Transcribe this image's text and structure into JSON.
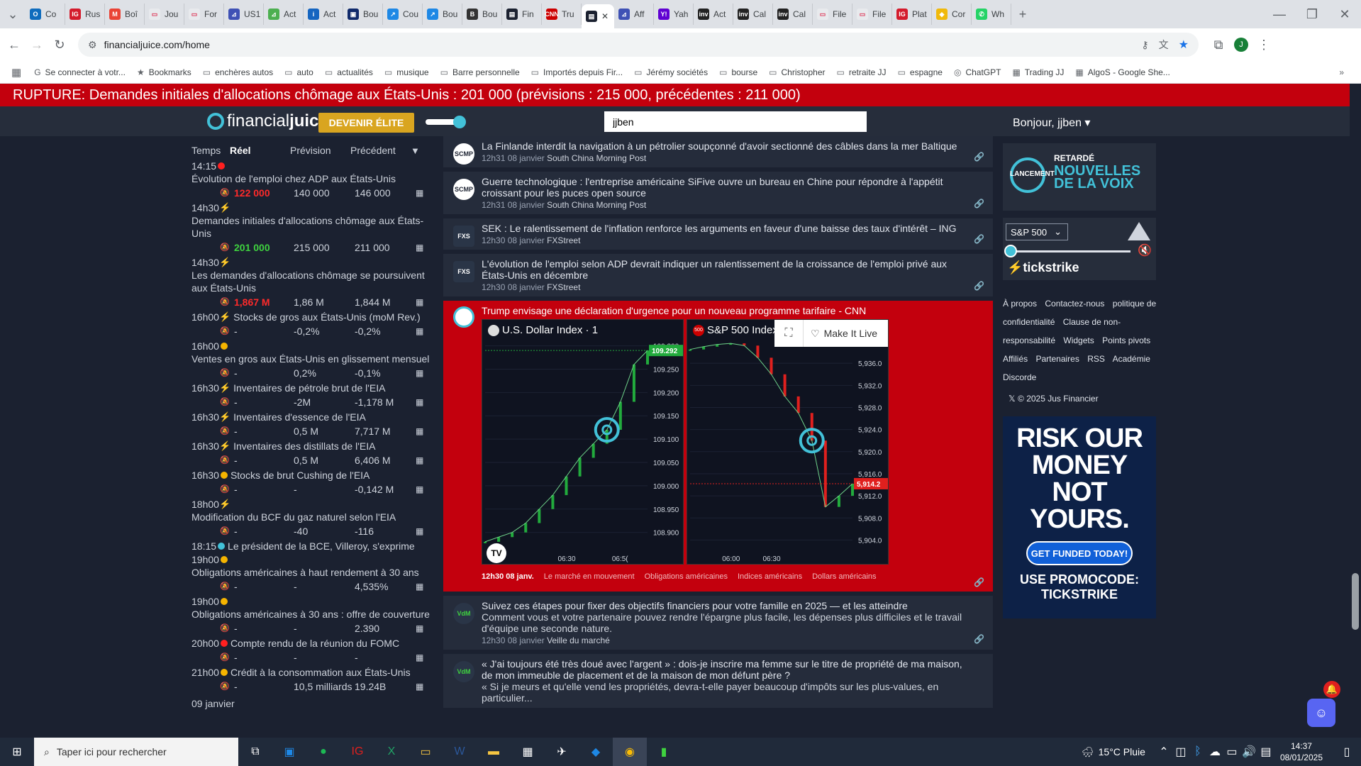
{
  "browser": {
    "tabs": [
      {
        "label": "Co",
        "color": "#0f6cbd",
        "glyph": "O"
      },
      {
        "label": "Rus",
        "color": "#d41b2c",
        "glyph": "IG"
      },
      {
        "label": "Boî",
        "color": "#ea4335",
        "glyph": "M"
      },
      {
        "label": "Jou",
        "color": "#e8eaed",
        "glyph": "▭"
      },
      {
        "label": "For",
        "color": "#e8eaed",
        "glyph": "▭"
      },
      {
        "label": "US1",
        "color": "#3f51b5",
        "glyph": "⊿"
      },
      {
        "label": "Act",
        "color": "#4caf50",
        "glyph": "⊿"
      },
      {
        "label": "Act",
        "color": "#1565c0",
        "glyph": "i"
      },
      {
        "label": "Bou",
        "color": "#102a6b",
        "glyph": "▣"
      },
      {
        "label": "Cou",
        "color": "#1e88e5",
        "glyph": "↗"
      },
      {
        "label": "Bou",
        "color": "#1e88e5",
        "glyph": "↗"
      },
      {
        "label": "Bou",
        "color": "#333333",
        "glyph": "B"
      },
      {
        "label": "Fin",
        "color": "#1b2130",
        "glyph": "▤"
      },
      {
        "label": "Tru",
        "color": "#cc0000",
        "glyph": "CNN"
      },
      {
        "label": "",
        "color": "#1b2130",
        "glyph": "▤",
        "active": true
      },
      {
        "label": "Aff",
        "color": "#3f51b5",
        "glyph": "⊿"
      },
      {
        "label": "Yah",
        "color": "#6001d2",
        "glyph": "Y!"
      },
      {
        "label": "Act",
        "color": "#222222",
        "glyph": "inv"
      },
      {
        "label": "Cal",
        "color": "#222222",
        "glyph": "inv"
      },
      {
        "label": "Cal",
        "color": "#222222",
        "glyph": "inv"
      },
      {
        "label": "File",
        "color": "#e8eaed",
        "glyph": "▭"
      },
      {
        "label": "File",
        "color": "#e8eaed",
        "glyph": "▭"
      },
      {
        "label": "Plat",
        "color": "#d41b2c",
        "glyph": "IG"
      },
      {
        "label": "Cor",
        "color": "#f0b90b",
        "glyph": "◆"
      },
      {
        "label": "Wh",
        "color": "#25d366",
        "glyph": "✆"
      }
    ],
    "url": "financialjuice.com/home",
    "profile_initial": "J",
    "bookmarks": [
      {
        "icon": "G",
        "label": "Se connecter à votr..."
      },
      {
        "icon": "★",
        "label": "Bookmarks"
      },
      {
        "icon": "▭",
        "label": "enchères autos"
      },
      {
        "icon": "▭",
        "label": "auto"
      },
      {
        "icon": "▭",
        "label": "actualités"
      },
      {
        "icon": "▭",
        "label": "musique"
      },
      {
        "icon": "▭",
        "label": "Barre personnelle"
      },
      {
        "icon": "▭",
        "label": "Importés depuis Fir..."
      },
      {
        "icon": "▭",
        "label": "Jérémy sociétés"
      },
      {
        "icon": "▭",
        "label": "bourse"
      },
      {
        "icon": "▭",
        "label": "Christopher"
      },
      {
        "icon": "▭",
        "label": "retraite JJ"
      },
      {
        "icon": "▭",
        "label": "espagne"
      },
      {
        "icon": "◎",
        "label": "ChatGPT"
      },
      {
        "icon": "▦",
        "label": "Trading JJ"
      },
      {
        "icon": "▦",
        "label": "AlgoS - Google She..."
      }
    ]
  },
  "site": {
    "breaking": "RUPTURE: Demandes initiales d'allocations chômage aux États-Unis : 201 000 (prévisions : 215 000, précédentes : 211 000)",
    "logo_light": "financial",
    "logo_bold": "juice",
    "elite_button": "DEVENIR ÉLITE",
    "search_value": "jjben",
    "greeting": "Bonjour, jjben ▾"
  },
  "calendar": {
    "headers": {
      "time": "Temps",
      "actual": "Réel",
      "forecast": "Prévision",
      "previous": "Précédent"
    },
    "events": [
      {
        "time": "14:15",
        "impact": "#ff2020",
        "title": "Évolution de l'emploi chez ADP aux États-Unis",
        "actual": "122 000",
        "actual_color": "#ff2a2a",
        "forecast": "140 000",
        "previous": "146 000",
        "title_inline": false
      },
      {
        "time": "14h30",
        "impact": "bolt-red",
        "title": "Demandes initiales d'allocations chômage aux États-Unis",
        "actual": "201 000",
        "actual_color": "#3fd23f",
        "forecast": "215 000",
        "previous": "211 000",
        "title_inline": false
      },
      {
        "time": "14h30",
        "impact": "bolt-yellow",
        "title": "Les demandes d'allocations chômage se poursuivent aux États-Unis",
        "actual": "1,867 M",
        "actual_color": "#ff2a2a",
        "forecast": "1,86 M",
        "previous": "1,844 M",
        "title_inline": false
      },
      {
        "time": "16h00",
        "impact": "bolt-yellow",
        "title": "Stocks de gros aux États-Unis (moM Rev.)",
        "actual": "-",
        "actual_color": "#cdd2db",
        "forecast": "-0,2%",
        "previous": "-0,2%",
        "title_inline": true
      },
      {
        "time": "16h00",
        "impact": "#f5b400",
        "title": "Ventes en gros aux États-Unis en glissement mensuel",
        "actual": "-",
        "actual_color": "#cdd2db",
        "forecast": "0,2%",
        "previous": "-0,1%",
        "title_inline": false
      },
      {
        "time": "16h30",
        "impact": "bolt-red",
        "title": "Inventaires de pétrole brut de l'EIA",
        "actual": "-",
        "actual_color": "#cdd2db",
        "forecast": "-2M",
        "previous": "-1,178 M",
        "title_inline": true
      },
      {
        "time": "16h30",
        "impact": "bolt-yellow",
        "title": "Inventaires d'essence de l'EIA",
        "actual": "-",
        "actual_color": "#cdd2db",
        "forecast": "0,5 M",
        "previous": "7,717 M",
        "title_inline": true
      },
      {
        "time": "16h30",
        "impact": "bolt-yellow",
        "title": "Inventaires des distillats de l'EIA",
        "actual": "-",
        "actual_color": "#cdd2db",
        "forecast": "0,5 M",
        "previous": "6,406 M",
        "title_inline": true
      },
      {
        "time": "16h30",
        "impact": "#f5b400",
        "title": "Stocks de brut Cushing de l'EIA",
        "actual": "-",
        "actual_color": "#cdd2db",
        "forecast": "-",
        "previous": "-0,142 M",
        "title_inline": true
      },
      {
        "time": "18h00",
        "impact": "bolt-yellow",
        "title": "Modification du BCF du gaz naturel selon l'EIA",
        "actual": "-",
        "actual_color": "#cdd2db",
        "forecast": "-40",
        "previous": "-116",
        "title_inline": false
      },
      {
        "time": "18:15",
        "impact": "#42c1d8",
        "title": "Le président de la BCE, Villeroy, s'exprime",
        "actual": null,
        "title_inline": true
      },
      {
        "time": "19h00",
        "impact": "#f5b400",
        "title": "Obligations américaines à haut rendement à 30 ans",
        "actual": "-",
        "actual_color": "#cdd2db",
        "forecast": "-",
        "previous": "4,535%",
        "title_inline": false
      },
      {
        "time": "19h00",
        "impact": "#f5b400",
        "title": "Obligations américaines à 30 ans : offre de couverture",
        "actual": "-",
        "actual_color": "#cdd2db",
        "forecast": "-",
        "previous": "2.390",
        "title_inline": false
      },
      {
        "time": "20h00",
        "impact": "#ff2020",
        "title": "Compte rendu de la réunion du FOMC",
        "actual": "-",
        "actual_color": "#cdd2db",
        "forecast": "-",
        "previous": "-",
        "title_inline": true
      },
      {
        "time": "21h00",
        "impact": "#f5b400",
        "title": "Crédit à la consommation aux États-Unis",
        "actual": "-",
        "actual_color": "#cdd2db",
        "forecast": "10,5 milliards",
        "previous": "19.24B",
        "title_inline": true
      }
    ],
    "footer_date": "09 janvier"
  },
  "feed": {
    "items_top": [
      {
        "avatar": "SCMP",
        "title": "La Finlande interdit la navigation à un pétrolier soupçonné d'avoir sectionné des câbles dans la mer Baltique",
        "time": "12h31 08 janvier",
        "source": "South China Morning Post"
      },
      {
        "avatar": "SCMP",
        "title": "Guerre technologique : l'entreprise américaine SiFive ouvre un bureau en Chine pour répondre à l'appétit croissant pour les puces open source",
        "time": "12h31 08 janvier",
        "source": "South China Morning Post"
      },
      {
        "avatar": "FXS",
        "title": "SEK : Le ralentissement de l'inflation renforce les arguments en faveur d'une baisse des taux d'intérêt – ING",
        "time": "12h30 08 janvier",
        "source": "FXStreet"
      },
      {
        "avatar": "FXS",
        "title": "L'évolution de l'emploi selon ADP devrait indiquer un ralentissement de la croissance de l'emploi privé aux États-Unis en décembre",
        "time": "12h30 08 janvier",
        "source": "FXStreet"
      }
    ],
    "highlight": {
      "title": "Trump envisage une déclaration d'urgence pour un nouveau programme tarifaire - CNN",
      "time": "12h30 08 janv.",
      "tags": [
        "Le marché en mouvement",
        "Obligations américaines",
        "Indices américains",
        "Dollars américains"
      ],
      "make_live": "Make It Live"
    },
    "items_bottom": [
      {
        "avatar": "VdM",
        "title": "Suivez ces étapes pour fixer des objectifs financiers pour votre famille en 2025 — et les atteindre",
        "body": "Comment vous et votre partenaire pouvez rendre l'épargne plus facile, les dépenses plus difficiles et le travail d'équipe une seconde nature.",
        "time": "12h30 08 janvier",
        "source": "Veille du marché"
      },
      {
        "avatar": "VdM",
        "title": "« J'ai toujours été très doué avec l'argent » : dois-je inscrire ma femme sur le titre de propriété de ma maison, de mon immeuble de placement et de la maison de mon défunt père ?",
        "body": "« Si je meurs et qu'elle vend les propriétés, devra-t-elle payer beaucoup d'impôts sur les plus-values, en particulier...",
        "time": "",
        "source": ""
      }
    ]
  },
  "chart_data": [
    {
      "type": "line",
      "title": "U.S. Dollar Index · 1",
      "x": [
        "06:00",
        "06:05",
        "06:10",
        "06:15",
        "06:20",
        "06:25",
        "06:30",
        "06:35",
        "06:40",
        "06:45",
        "06:50",
        "06:55",
        "07:00"
      ],
      "xticks": [
        "06:30",
        "06:5("
      ],
      "y": [
        108.88,
        108.89,
        108.9,
        108.92,
        108.95,
        108.98,
        109.02,
        109.06,
        109.09,
        109.12,
        109.18,
        109.26,
        109.29
      ],
      "yticks": [
        "109.300",
        "109.250",
        "109.200",
        "109.150",
        "109.100",
        "109.050",
        "109.000",
        "108.950",
        "108.900"
      ],
      "ylim": [
        108.86,
        109.31
      ],
      "last_value": "109.292",
      "last_color": "#22ab3d"
    },
    {
      "type": "line",
      "title": "S&P 500 Index · 1",
      "badge": "500",
      "x": [
        "05:30",
        "05:40",
        "05:50",
        "06:00",
        "06:10",
        "06:20",
        "06:30",
        "06:40",
        "06:50",
        "06:55",
        "07:00",
        "07:05",
        "07:10"
      ],
      "xticks": [
        "06:00",
        "06:30"
      ],
      "y": [
        5938.5,
        5939.0,
        5939.4,
        5939.6,
        5939.2,
        5937.0,
        5934.0,
        5930.0,
        5927.0,
        5922.0,
        5910.0,
        5912.0,
        5914.2
      ],
      "yticks": [
        "5,936.0",
        "5,932.0",
        "5,928.0",
        "5,924.0",
        "5,920.0",
        "5,916.0",
        "5,912.0",
        "5,908.0",
        "5,904.0"
      ],
      "ylim": [
        5902,
        5940
      ],
      "last_value": "5,914.2",
      "last_color": "#e0201e"
    }
  ],
  "right": {
    "voice_small": "RETARDÉ",
    "voice_launch": "LANCEMENT",
    "voice_big1": "NOUVELLES",
    "voice_big2": "DE LA VOIX",
    "index_select": "S&P 500",
    "tickstrike": "tickstrike",
    "links": [
      "À propos",
      "Contactez-nous",
      "politique de confidentialité",
      "Clause de non-responsabilité",
      "Widgets",
      "Points pivots",
      "Affiliés",
      "Partenaires",
      "RSS",
      "Académie",
      "Discorde"
    ],
    "copyright": "© 2025 Jus Financier",
    "ad_lines": [
      "RISK OUR",
      "MONEY",
      "NOT",
      "YOURS."
    ],
    "ad_button": "GET FUNDED TODAY!",
    "ad_promo1": "USE PROMOCODE:",
    "ad_promo2": "TICKSTRIKE"
  },
  "taskbar": {
    "search_placeholder": "Taper ici pour rechercher",
    "weather": "15°C  Pluie",
    "time": "14:37",
    "date": "08/01/2025",
    "notif_count": "1"
  }
}
